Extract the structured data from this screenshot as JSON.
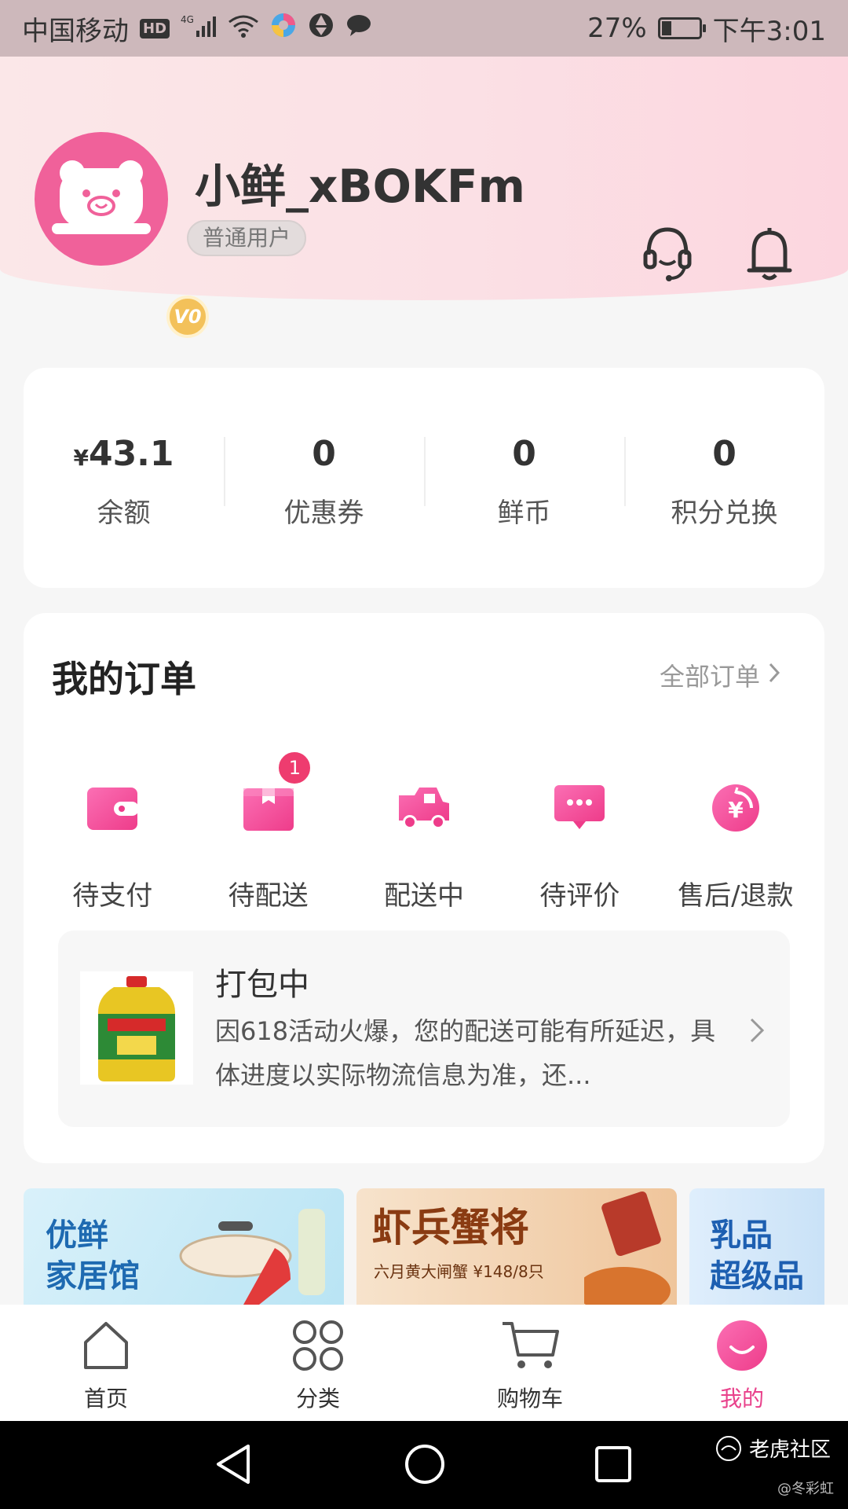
{
  "status_bar": {
    "carrier": "中国移动",
    "hd": "HD",
    "network": "4G",
    "battery_percent": "27%",
    "battery_level": 0.27,
    "time": "下午3:01"
  },
  "profile": {
    "username": "小鲜_xBOKFm",
    "user_type": "普通用户",
    "level": "V0"
  },
  "stats": [
    {
      "currency": "¥",
      "value": "43.1",
      "label": "余额"
    },
    {
      "currency": "",
      "value": "0",
      "label": "优惠券"
    },
    {
      "currency": "",
      "value": "0",
      "label": "鲜币"
    },
    {
      "currency": "",
      "value": "0",
      "label": "积分兑换"
    }
  ],
  "orders": {
    "title": "我的订单",
    "all_orders_label": "全部订单",
    "statuses": [
      {
        "label": "待支付",
        "icon": "wallet-icon"
      },
      {
        "label": "待配送",
        "icon": "package-icon",
        "badge": "1"
      },
      {
        "label": "配送中",
        "icon": "delivery-truck-icon"
      },
      {
        "label": "待评价",
        "icon": "comment-icon"
      },
      {
        "label": "售后/退款",
        "icon": "refund-icon"
      }
    ],
    "tracking": {
      "title": "打包中",
      "description": "因618活动火爆，您的配送可能有所延迟，具体进度以实际物流信息为准，还..."
    }
  },
  "banners": {
    "home": "优鲜\n家居馆",
    "crab_title": "虾兵蟹将",
    "crab_sub": "六月黄大闸蟹 ¥148/8只",
    "dairy": "乳品\n超级品"
  },
  "bottom_nav": [
    {
      "label": "首页",
      "icon": "home-icon"
    },
    {
      "label": "分类",
      "icon": "category-icon"
    },
    {
      "label": "购物车",
      "icon": "cart-icon"
    },
    {
      "label": "我的",
      "icon": "profile-icon",
      "active": true
    }
  ],
  "watermark": {
    "brand": "老虎社区",
    "author": "@冬彩虹"
  },
  "colors": {
    "accent": "#e9418b",
    "header_bg": "#fbe0e5",
    "badge": "#ee3c6f"
  }
}
